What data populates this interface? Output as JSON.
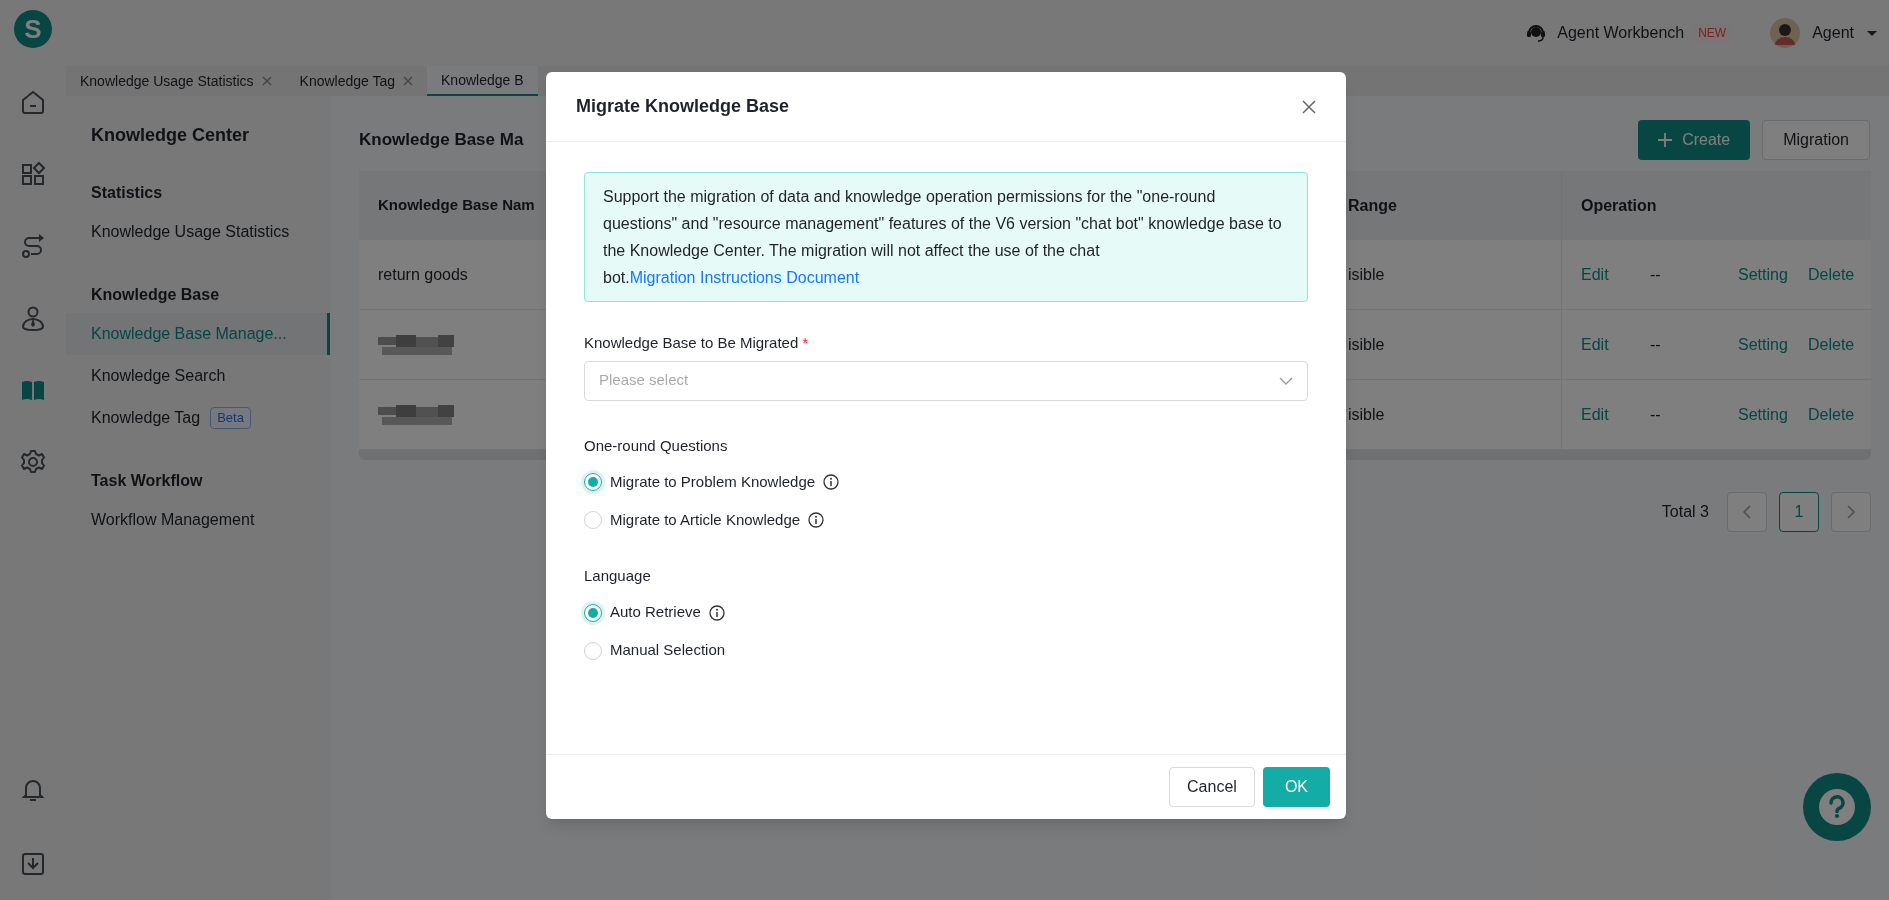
{
  "logo_letter": "S",
  "top_bar": {
    "workbench": "Agent Workbench",
    "badge": "NEW",
    "user": "Agent"
  },
  "rail": [
    {
      "kind": "home",
      "selected": false
    },
    {
      "kind": "apps",
      "selected": false
    },
    {
      "kind": "flow",
      "selected": false
    },
    {
      "kind": "person",
      "selected": false
    },
    {
      "kind": "book",
      "selected": true
    },
    {
      "kind": "gear",
      "selected": false
    }
  ],
  "rail_bottom": [
    {
      "kind": "bell"
    },
    {
      "kind": "download"
    }
  ],
  "tabs": [
    {
      "label": "Knowledge Usage Statistics",
      "selected": false,
      "closable": true
    },
    {
      "label": "Knowledge Tag",
      "selected": false,
      "closable": true
    },
    {
      "label": "Knowledge B",
      "selected": true,
      "closable": false
    }
  ],
  "sidebar": {
    "title": "Knowledge Center",
    "sections": [
      {
        "heading": "Statistics",
        "items": [
          {
            "label": "Knowledge Usage Statistics",
            "selected": false
          }
        ]
      },
      {
        "heading": "Knowledge Base",
        "items": [
          {
            "label": "Knowledge Base Manage...",
            "selected": true
          },
          {
            "label": "Knowledge Search",
            "selected": false
          },
          {
            "label": "Knowledge Tag",
            "selected": false,
            "badge": "Beta"
          }
        ]
      },
      {
        "heading": "Task Workflow",
        "items": [
          {
            "label": "Workflow Management",
            "selected": false
          }
        ]
      }
    ]
  },
  "page": {
    "title": "Knowledge Base Ma",
    "create_button": "Create",
    "migration_button": "Migration"
  },
  "table": {
    "columns": [
      "Knowledge Base Nam",
      "Range",
      "Operation"
    ],
    "rows": [
      {
        "name": "return goods",
        "name_redacted": false,
        "range": "isible",
        "actions": [
          "Edit",
          "--",
          "Setting",
          "Delete"
        ]
      },
      {
        "name_redacted": true,
        "range": "isible",
        "actions": [
          "Edit",
          "--",
          "Setting",
          "Delete"
        ]
      },
      {
        "name_redacted": true,
        "range": "isible",
        "actions": [
          "Edit",
          "--",
          "Setting",
          "Delete"
        ]
      }
    ]
  },
  "pagination": {
    "total": "Total 3",
    "pages": [
      {
        "label": "1",
        "selected": true
      }
    ]
  },
  "modal": {
    "title": "Migrate Knowledge Base",
    "notice": "Support the migration of data and knowledge operation permissions for the \"one-round questions\" and \"resource management\" features of the V6 version \"chat bot\" knowledge base to the Knowledge Center. The migration will not affect the use of the chat bot.",
    "notice_link": "Migration Instructions Document",
    "field": {
      "label": "Knowledge Base to Be Migrated",
      "required_mark": "*",
      "placeholder": "Please select"
    },
    "groups": [
      {
        "label": "One-round Questions",
        "options": [
          {
            "label": "Migrate to Problem Knowledge",
            "selected": true,
            "info": true
          },
          {
            "label": "Migrate to Article Knowledge",
            "selected": false,
            "info": true
          }
        ]
      },
      {
        "label": "Language",
        "options": [
          {
            "label": "Auto Retrieve",
            "selected": true,
            "info": true
          },
          {
            "label": "Manual Selection",
            "selected": false,
            "info": false
          }
        ]
      }
    ],
    "cancel": "Cancel",
    "ok": "OK"
  }
}
